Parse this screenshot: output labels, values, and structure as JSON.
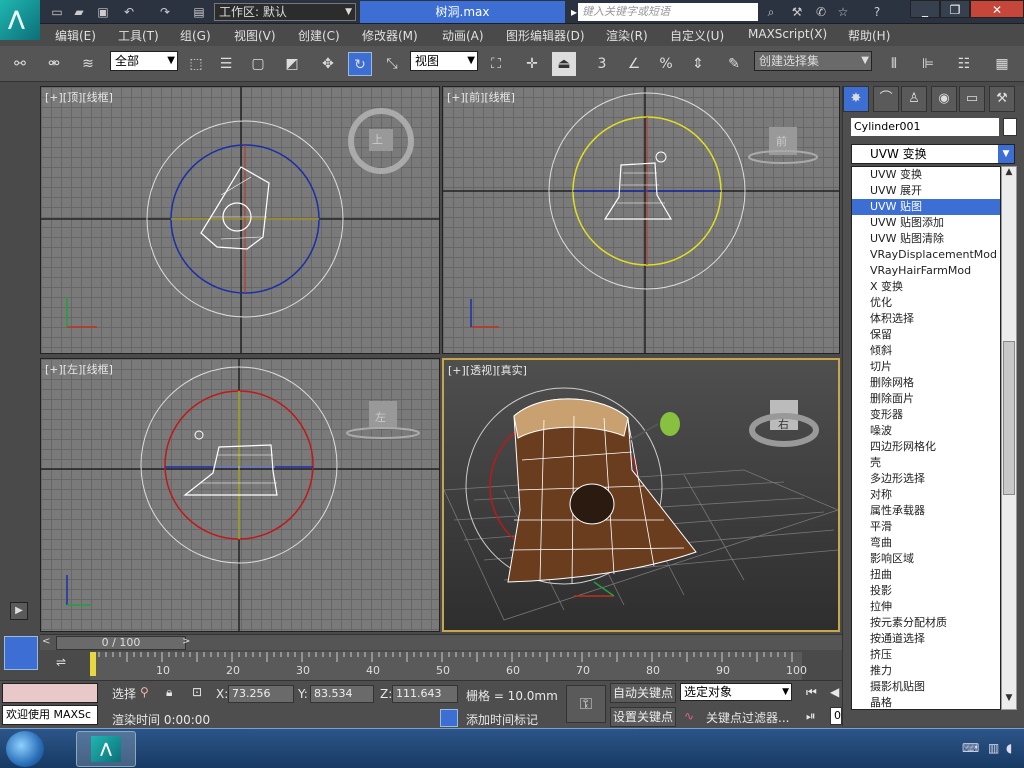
{
  "title": {
    "workspace_label": "工作区: 默认",
    "file_name": "树洞.max",
    "search_placeholder": "键入关键字或短语"
  },
  "menu": [
    "编辑(E)",
    "工具(T)",
    "组(G)",
    "视图(V)",
    "创建(C)",
    "修改器(M)",
    "动画(A)",
    "图形编辑器(D)",
    "渲染(R)",
    "自定义(U)",
    "MAXScript(X)",
    "帮助(H)"
  ],
  "toolbar": {
    "selection_filter": "全部",
    "reference_coord": "视图",
    "named_selection": "创建选择集"
  },
  "viewports": {
    "top": "[+][顶][线框]",
    "front": "[+][前][线框]",
    "left": "[+][左][线框]",
    "perspective": "[+][透视][真实]",
    "cube_top": "上",
    "cube_front": "前",
    "cube_left": "左",
    "cube_persp": "右"
  },
  "command_panel": {
    "object_name": "Cylinder001",
    "modifier_selected": "UVW 变换",
    "modifier_list": [
      "UVW 变换",
      "UVW 展开",
      "UVW 贴图",
      "UVW 贴图添加",
      "UVW 贴图清除",
      "VRayDisplacementMod",
      "VRayHairFarmMod",
      "X 变换",
      "优化",
      "体积选择",
      "保留",
      "倾斜",
      "切片",
      "删除网格",
      "删除面片",
      "变形器",
      "噪波",
      "四边形网格化",
      "壳",
      "多边形选择",
      "对称",
      "属性承载器",
      "平滑",
      "弯曲",
      "影响区域",
      "扭曲",
      "投影",
      "拉伸",
      "按元素分配材质",
      "按通道选择",
      "挤压",
      "推力",
      "摄影机贴图",
      "晶格"
    ],
    "highlighted_index": 2
  },
  "timeline": {
    "frame_display": "0 / 100",
    "ticks": [
      "10",
      "20",
      "30",
      "40",
      "50",
      "60",
      "70",
      "80",
      "90",
      "100"
    ]
  },
  "status": {
    "welcome": "欢迎使用 MAXSc",
    "select_label": "选择",
    "x_label": "X:",
    "x_value": "73.256",
    "y_label": "Y:",
    "y_value": "83.534",
    "z_label": "Z:",
    "z_value": "111.643",
    "grid": "栅格 = 10.0mm",
    "render_time": "渲染时间  0:00:00",
    "add_time_tag": "添加时间标记",
    "auto_key": "自动关键点",
    "set_key": "设置关键点",
    "key_mode": "选定对象",
    "key_filters": "关键点过滤器...",
    "frame_value": "0"
  }
}
